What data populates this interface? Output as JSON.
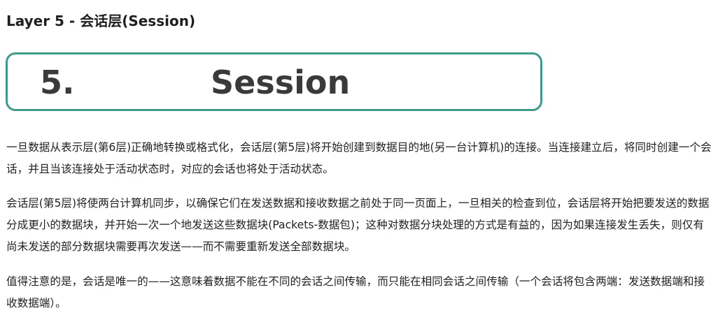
{
  "heading": "Layer 5 - 会话层(Session)",
  "banner": {
    "number": "5.",
    "word": "Session"
  },
  "paragraphs": [
    "一旦数据从表示层(第6层)正确地转换或格式化，会话层(第5层)将开始创建到数据目的地(另一台计算机)的连接。当连接建立后，将同时创建一个会话，并且当该连接处于活动状态时，对应的会话也将处于活动状态。",
    "会话层(第5层)将使两台计算机同步，以确保它们在发送数据和接收数据之前处于同一页面上，一旦相关的检查到位，会话层将开始把要发送的数据分成更小的数据块，并开始一次一个地发送这些数据块(Packets-数据包)；这种对数据分块处理的方式是有益的，因为如果连接发生丢失，则仅有尚未发送的部分数据块需要再次发送——而不需要重新发送全部数据块。",
    "值得注意的是，会话是唯一的——这意味着数据不能在不同的会话之间传输，而只能在相同会话之间传输（一个会话将包含两端：发送数据端和接收数据端）。"
  ],
  "colors": {
    "banner_border": "#3e9b86",
    "banner_text": "#3a3a3a",
    "body_text": "#222222"
  }
}
